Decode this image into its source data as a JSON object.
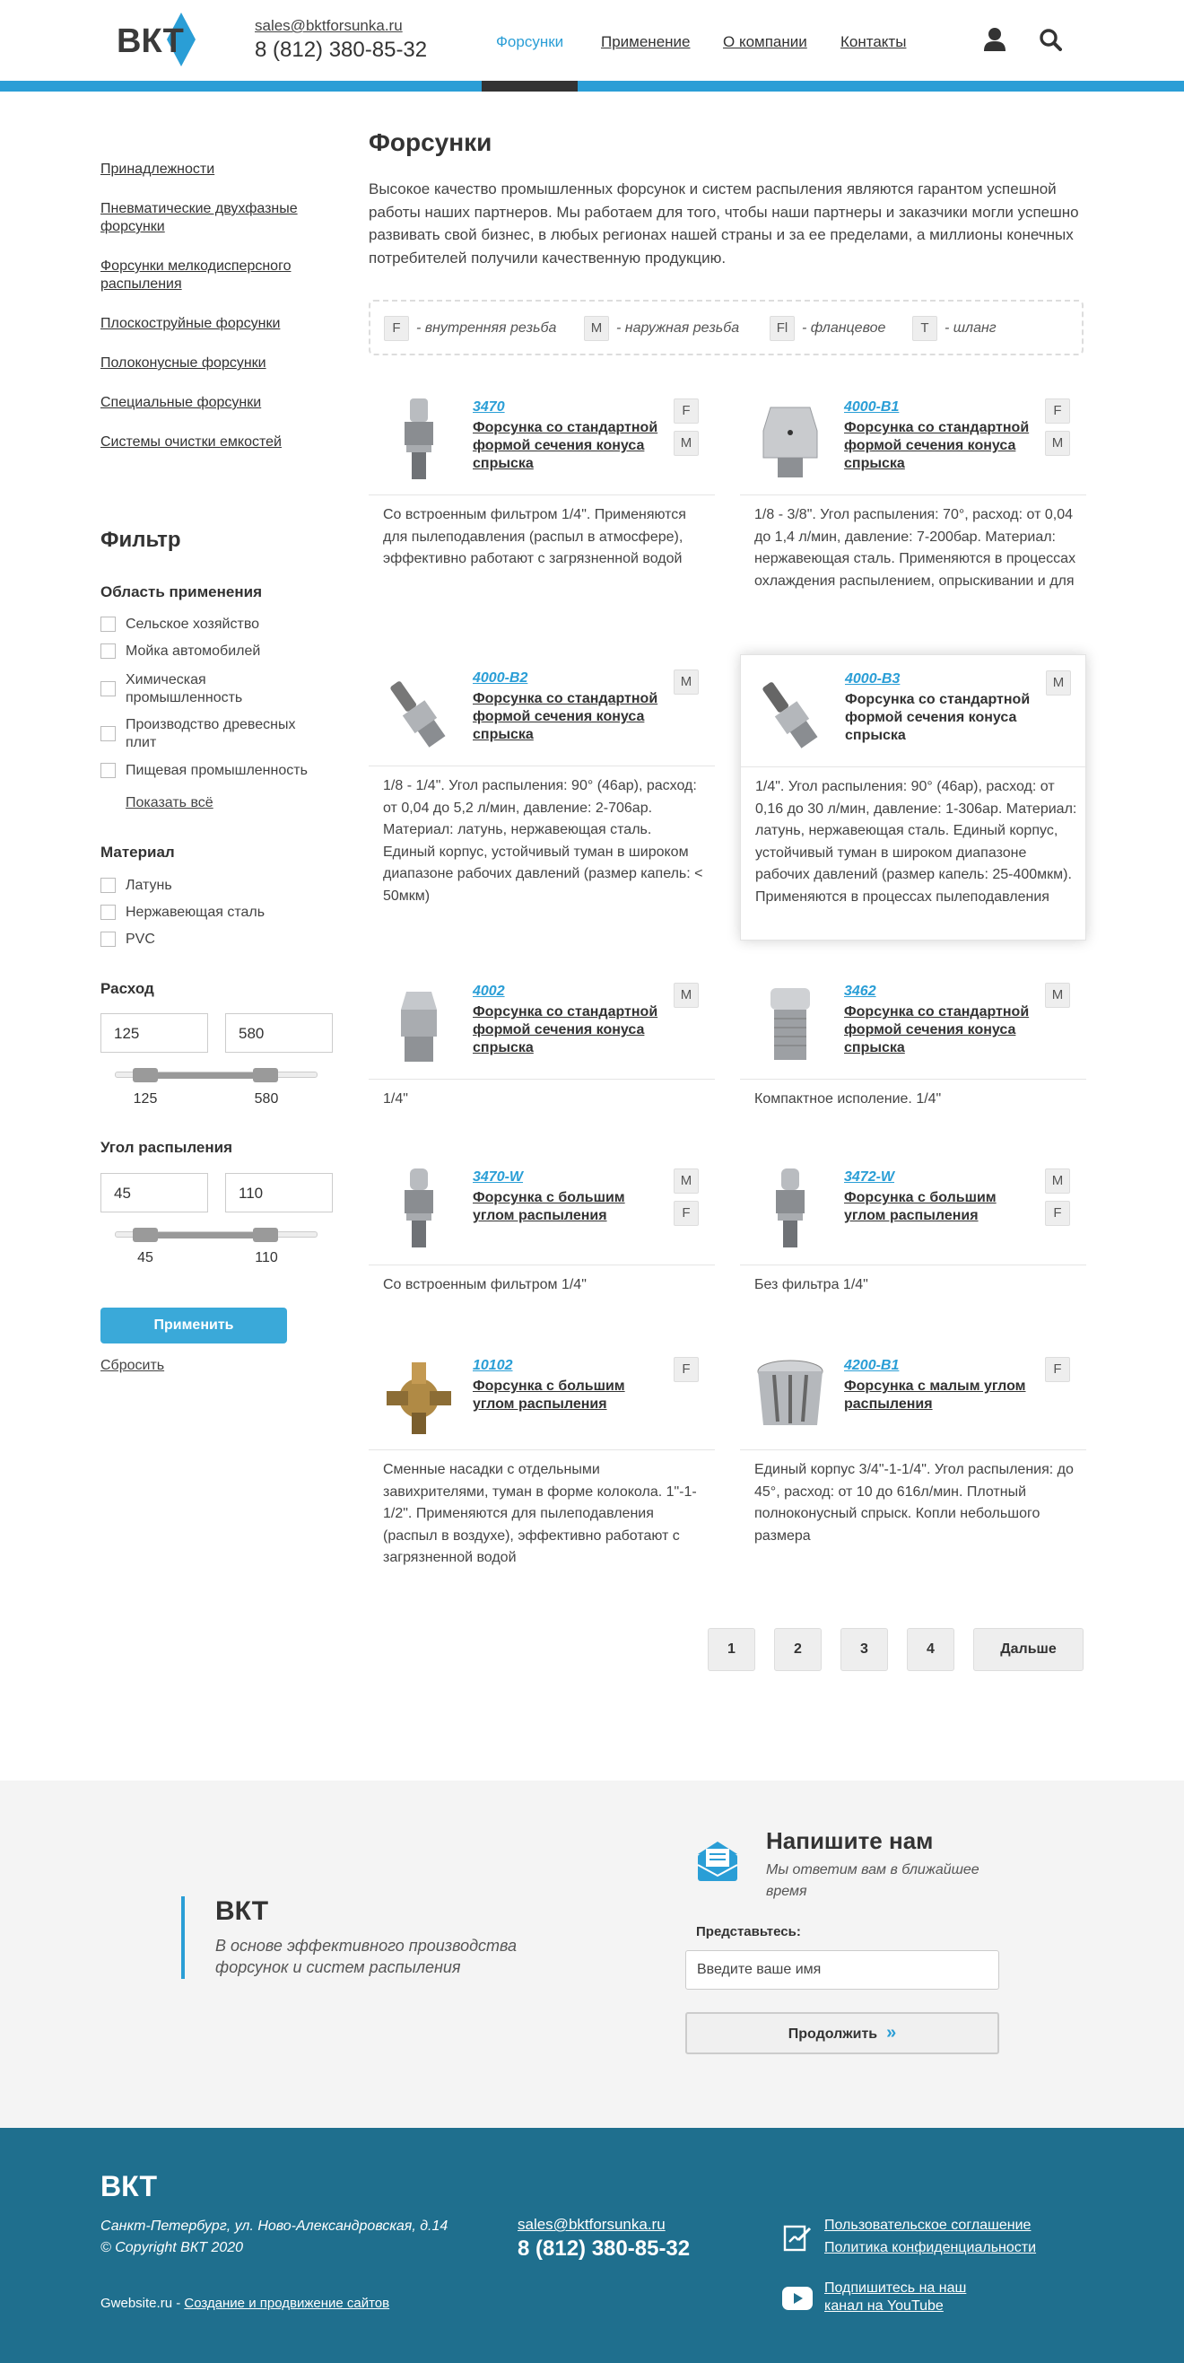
{
  "header": {
    "logo_text": "ВКТ",
    "email": "sales@bktforsunka.ru",
    "phone": "8 (812) 380-85-32",
    "nav": [
      "Форсунки",
      "Применение",
      "О компании",
      "Контакты"
    ]
  },
  "sidebar": {
    "categories": [
      "Принадлежности",
      "Пневматические двухфазные форсунки",
      "Форсунки мелкодисперсного распыления",
      "Плоскоструйные форсунки",
      "Полоконусные форсунки",
      "Специальные форсунки",
      "Системы очистки емкостей"
    ]
  },
  "filter": {
    "title": "Фильтр",
    "area_title": "Область применения",
    "areas": [
      "Сельское хозяйство",
      "Мойка автомобилей",
      "Химическая промышленность",
      "Производство древесных плит",
      "Пищевая промышленность"
    ],
    "show_all": "Показать всё",
    "material_title": "Материал",
    "materials": [
      "Латунь",
      "Нержавеющая сталь",
      "PVC"
    ],
    "flow_title": "Расход",
    "flow_min": "125",
    "flow_max": "580",
    "angle_title": "Угол распыления",
    "angle_min": "45",
    "angle_max": "110",
    "apply": "Применить",
    "reset": "Сбросить"
  },
  "main": {
    "title": "Форсунки",
    "intro": "Высокое качество промышленных форсунок и систем распыления являются гарантом успешной работы наших партнеров. Мы работаем для того, чтобы наши партнеры и заказчики могли успешно развивать свой бизнес, в любых регионах нашей страны и за ее пределами, а миллионы конечных потребителей получили качественную продукцию.",
    "legend": [
      {
        "badge": "F",
        "text": "- внутренняя резьба"
      },
      {
        "badge": "M",
        "text": "- наружная резьба"
      },
      {
        "badge": "Fl",
        "text": "- фланцевое"
      },
      {
        "badge": "T",
        "text": "- шланг"
      }
    ],
    "products": [
      {
        "code": "3470",
        "title": "Форсунка со стандартной формой сечения конуса спрыска",
        "badges": [
          "F",
          "M"
        ],
        "desc": "Со встроенным фильтром 1/4\". Применяются для пылеподавления (распыл в атмосфере), эффективно работают с загрязненной водой"
      },
      {
        "code": "4000-B1",
        "title": "Форсунка со стандартной формой сечения конуса спрыска",
        "badges": [
          "F",
          "M"
        ],
        "desc": "1/8 - 3/8\". Угол распыления: 70°, расход: от 0,04 до 1,4 л/мин, давление: 7-200бар. Материал: нержавеющая сталь. Применяются в процессах охлаждения распылением, опрыскивании и для"
      },
      {
        "code": "4000-B2",
        "title": "Форсунка со стандартной формой сечения конуса спрыска",
        "badges": [
          "M"
        ],
        "desc": "1/8 - 1/4\". Угол распыления: 90° (46ар), расход: от 0,04 до 5,2 л/мин, давление: 2-706ар. Материал: латунь, нержавеющая сталь. Единый корпус, устойчивый туман в широком диапазоне рабочих давлений (размер капель: < 50мкм)"
      },
      {
        "code": "4000-B3",
        "title": "Форсунка со стандартной формой сечения конуса спрыска",
        "badges": [
          "M"
        ],
        "desc": "1/4\". Угол распыления: 90° (46ар), расход: от 0,16 до 30 л/мин, давление: 1-306ар. Материал: латунь, нержавеющая сталь. Единый корпус, устойчивый туман в широком диапазоне рабочих давлений (размер капель: 25-400мкм). Применяются в процессах пылеподавления"
      },
      {
        "code": "4002",
        "title": "Форсунка со стандартной формой сечения конуса спрыска",
        "badges": [
          "M"
        ],
        "desc": "1/4\""
      },
      {
        "code": "3462",
        "title": "Форсунка со стандартной формой сечения конуса спрыска",
        "badges": [
          "M"
        ],
        "desc": "Компактное исполение. 1/4\""
      },
      {
        "code": "3470-W",
        "title": "Форсунка с большим углом распыления",
        "badges": [
          "M",
          "F"
        ],
        "desc": "Со встроенным фильтром 1/4\""
      },
      {
        "code": "3472-W",
        "title": "Форсунка с большим углом распыления",
        "badges": [
          "M",
          "F"
        ],
        "desc": "Без фильтра 1/4\""
      },
      {
        "code": "10102",
        "title": "Форсунка с большим углом распыления",
        "badges": [
          "F"
        ],
        "desc": "Сменные насадки с отдельными завихрителями, туман в форме колокола. 1\"-1-1/2\". Применяются для пылеподавления (распыл в воздухе), эффективно работают с загрязненной водой"
      },
      {
        "code": "4200-B1",
        "title": "Форсунка с малым углом распыления",
        "badges": [
          "F"
        ],
        "desc": "Единый корпус 3/4\"-1-1/4\". Угол распыления: до 45°, расход: от 10 до 616л/мин. Плотный полноконусный спрыск. Копли небольшого размера"
      }
    ],
    "pagination": [
      "1",
      "2",
      "3",
      "4",
      "Дальше"
    ]
  },
  "contact": {
    "brand": "ВКТ",
    "slogan": "В основе эффективного производства форсунок и систем распыления",
    "title": "Напишите нам",
    "subtitle": "Мы ответим вам в ближайшее время",
    "label": "Представьтесь:",
    "placeholder": "Введите ваше имя",
    "button": "Продолжить"
  },
  "footer": {
    "brand": "ВКТ",
    "address": "Санкт-Петербург, ул. Ново-Александровская, д.14",
    "copyright": "© Copyright ВКТ 2020",
    "dev_prefix": "Gwebsite.ru - ",
    "dev_link": "Создание и продвижение сайтов",
    "email": "sales@bktforsunka.ru",
    "phone": "8 (812) 380-85-32",
    "link_terms": "Пользовательское соглашение",
    "link_privacy": "Политика конфиденциальности",
    "link_youtube": "Подпишитесь на наш канал на YouTube"
  },
  "colors": {
    "accent": "#2a9ed6",
    "footer": "#1f6f8e",
    "contact_bg": "#f4f4f4"
  }
}
